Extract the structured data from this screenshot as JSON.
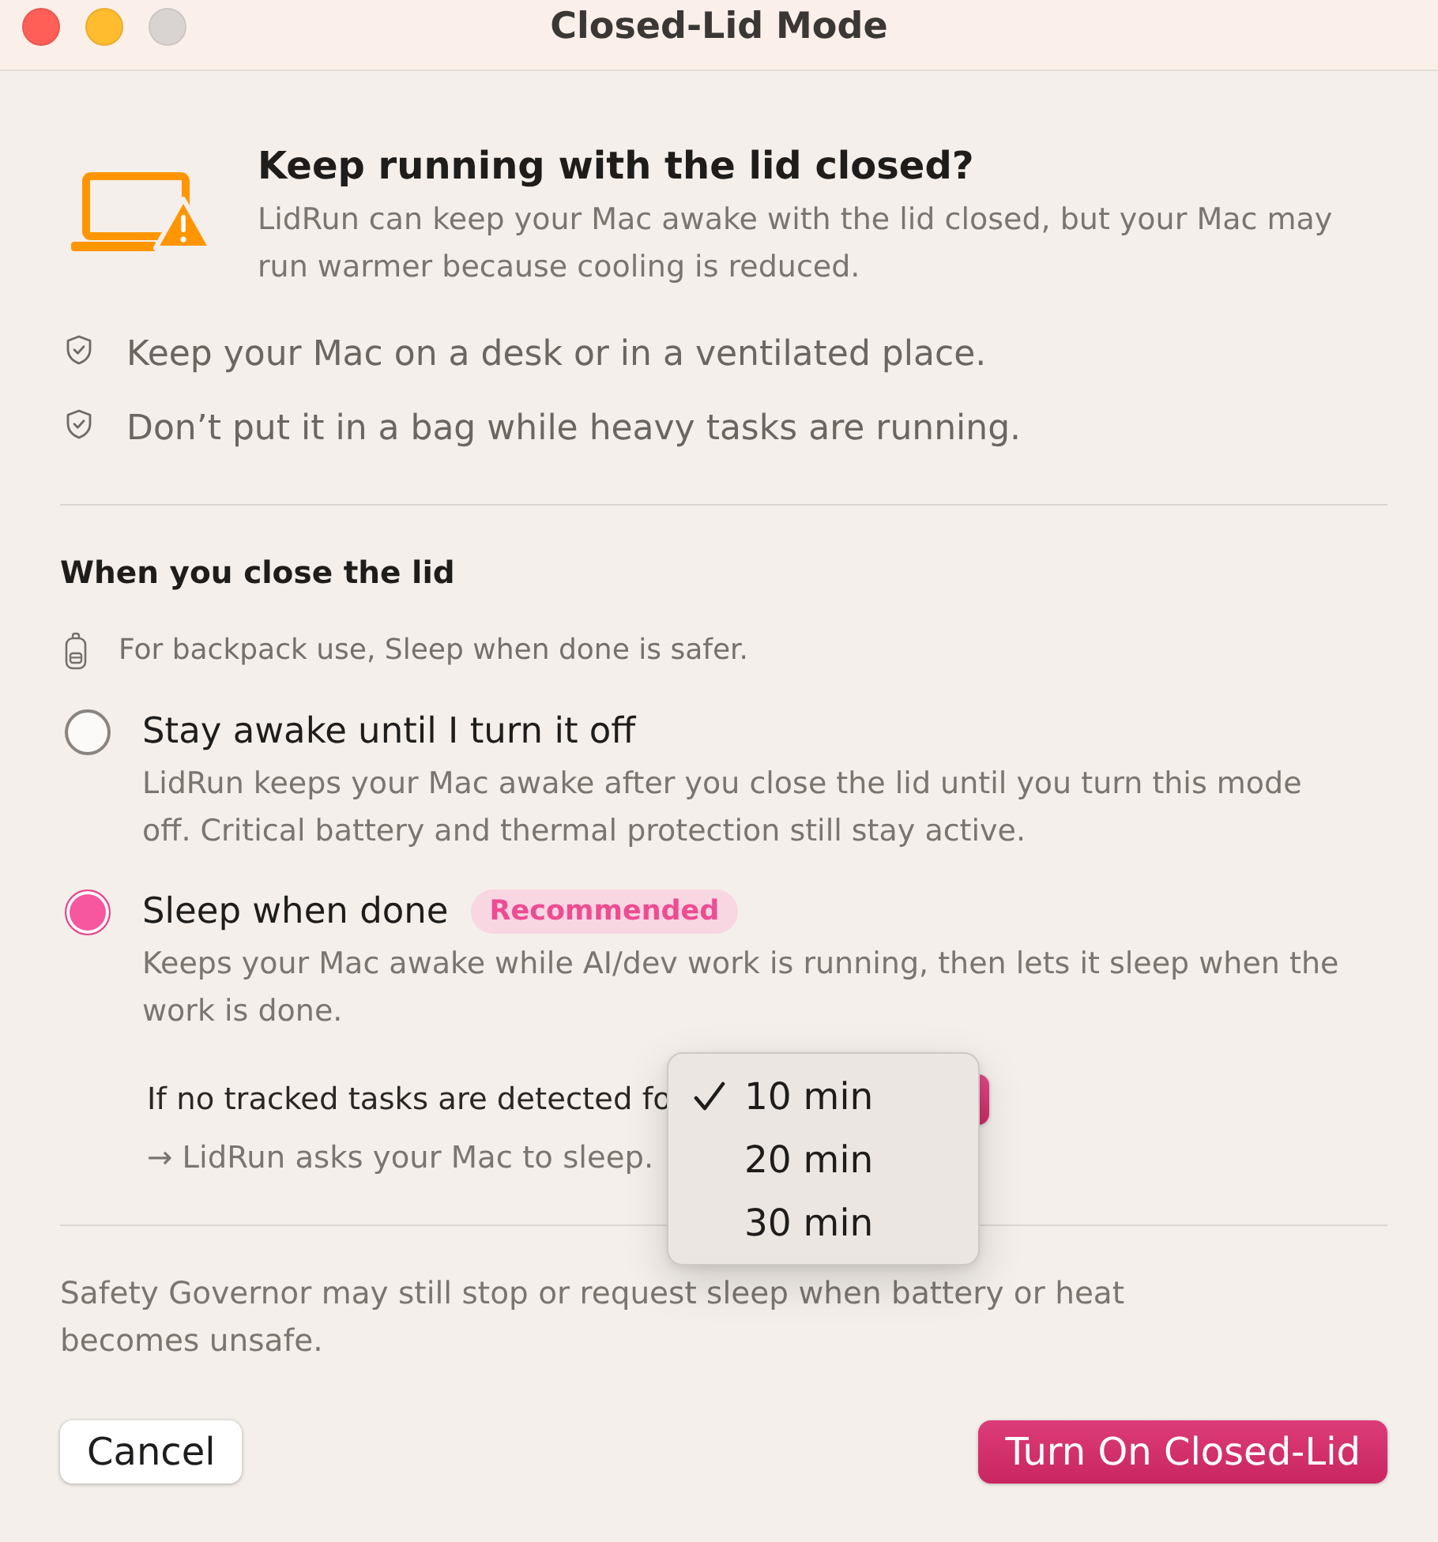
{
  "window": {
    "title": "Closed-Lid Mode",
    "controls": [
      {
        "kind": "close",
        "disabled": false
      },
      {
        "kind": "minimize",
        "disabled": false
      },
      {
        "kind": "zoom",
        "disabled": true
      }
    ]
  },
  "header": {
    "title": "Keep running with the lid closed?",
    "description": "LidRun can keep your Mac awake with the lid closed, but your Mac may run warmer because cooling is reduced."
  },
  "tips": [
    "Keep your Mac on a desk or in a ventilated place.",
    "Don’t put it in a bag while heavy tasks are running."
  ],
  "lid_section": {
    "heading": "When you close the lid",
    "hint": "For backpack use, Sleep when done is safer.",
    "options": [
      {
        "label": "Stay awake until I turn it off",
        "description": "LidRun keeps your Mac awake after you close the lid until you turn this mode off. Critical battery and thermal protection still stay active.",
        "selected": false
      },
      {
        "label": "Sleep when done",
        "badge": "Recommended",
        "description": "Keeps your Mac awake while AI/dev work is running, then lets it sleep when the work is done.",
        "selected": true
      }
    ],
    "timeout": {
      "label": "If no tracked tasks are detected fo",
      "menu": [
        {
          "label": "10 min",
          "selected": true
        },
        {
          "label": "20 min",
          "selected": false
        },
        {
          "label": "30 min",
          "selected": false
        }
      ],
      "result": "→ LidRun asks your Mac to sleep."
    }
  },
  "footer_note": "Safety Governor may still stop or request sleep when battery or heat becomes unsafe.",
  "buttons": [
    {
      "label": "Cancel",
      "kind": "secondary"
    },
    {
      "label": "Turn On Closed-Lid",
      "kind": "primary"
    }
  ]
}
